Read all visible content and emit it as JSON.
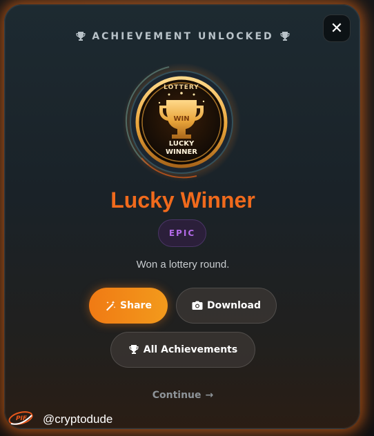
{
  "header": {
    "label": "ACHIEVEMENT UNLOCKED",
    "icon": "trophy-icon"
  },
  "close_button": {
    "icon": "close-icon",
    "glyph": "✕"
  },
  "achievement": {
    "badge": {
      "top_text": "LOTTERY",
      "center_text": "WIN",
      "bottom_text_line1": "LUCKY",
      "bottom_text_line2": "WINNER",
      "icon": "trophy-icon"
    },
    "title": "Lucky Winner",
    "rarity": "EPIC",
    "description": "Won a lottery round."
  },
  "actions": {
    "share_label": "Share",
    "share_icon": "magic-wand-icon",
    "download_label": "Download",
    "download_icon": "camera-icon",
    "all_achievements_label": "All Achievements",
    "all_achievements_icon": "trophy-icon",
    "continue_label": "Continue",
    "continue_icon": "arrow-right-icon",
    "continue_glyph": "→"
  },
  "watermark": {
    "logo_text": "PIF",
    "username": "@cryptodude"
  },
  "colors": {
    "accent_orange": "#f06a1c",
    "share_gradient_start": "#f07a14",
    "share_gradient_end": "#f39a1c",
    "rarity_purple": "#b36ae8",
    "rarity_bg": "#2b1f3a",
    "header_text": "#b8c2c8",
    "badge_gold": "#e8a43a"
  }
}
